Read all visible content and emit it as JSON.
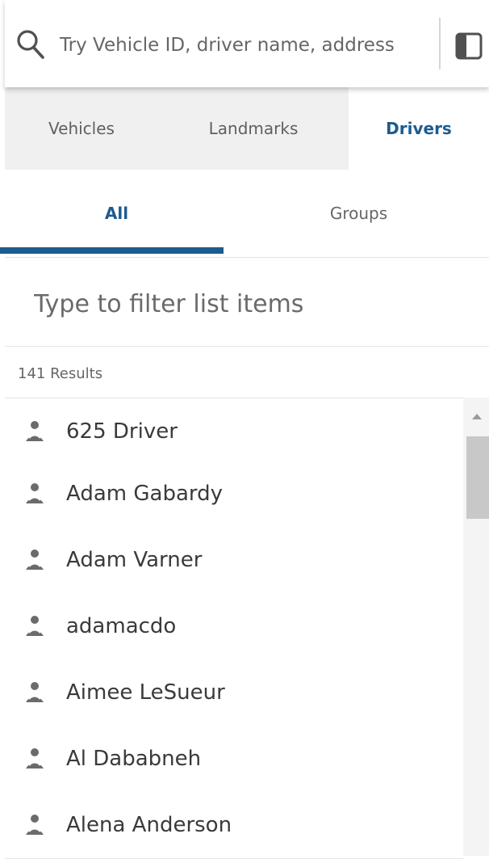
{
  "search": {
    "placeholder": "Try Vehicle ID, driver name, address",
    "icon": "search-icon",
    "panel_icon": "panel-toggle-icon"
  },
  "type_tabs": [
    {
      "label": "Vehicles",
      "active": false
    },
    {
      "label": "Landmarks",
      "active": false
    },
    {
      "label": "Drivers",
      "active": true
    }
  ],
  "sub_tabs": [
    {
      "label": "All",
      "active": true
    },
    {
      "label": "Groups",
      "active": false
    }
  ],
  "filter": {
    "placeholder": "Type to filter list items"
  },
  "results": {
    "count_text": "141 Results"
  },
  "drivers": [
    {
      "name": "625 Driver"
    },
    {
      "name": "Adam Gabardy"
    },
    {
      "name": "Adam Varner"
    },
    {
      "name": "adamacdo"
    },
    {
      "name": "Aimee LeSueur"
    },
    {
      "name": "Al Dababneh"
    },
    {
      "name": "Alena Anderson"
    }
  ],
  "colors": {
    "accent": "#1e5b8e",
    "inactive_tab_bg": "#f0f0f0",
    "divider": "#e4e4e4"
  }
}
